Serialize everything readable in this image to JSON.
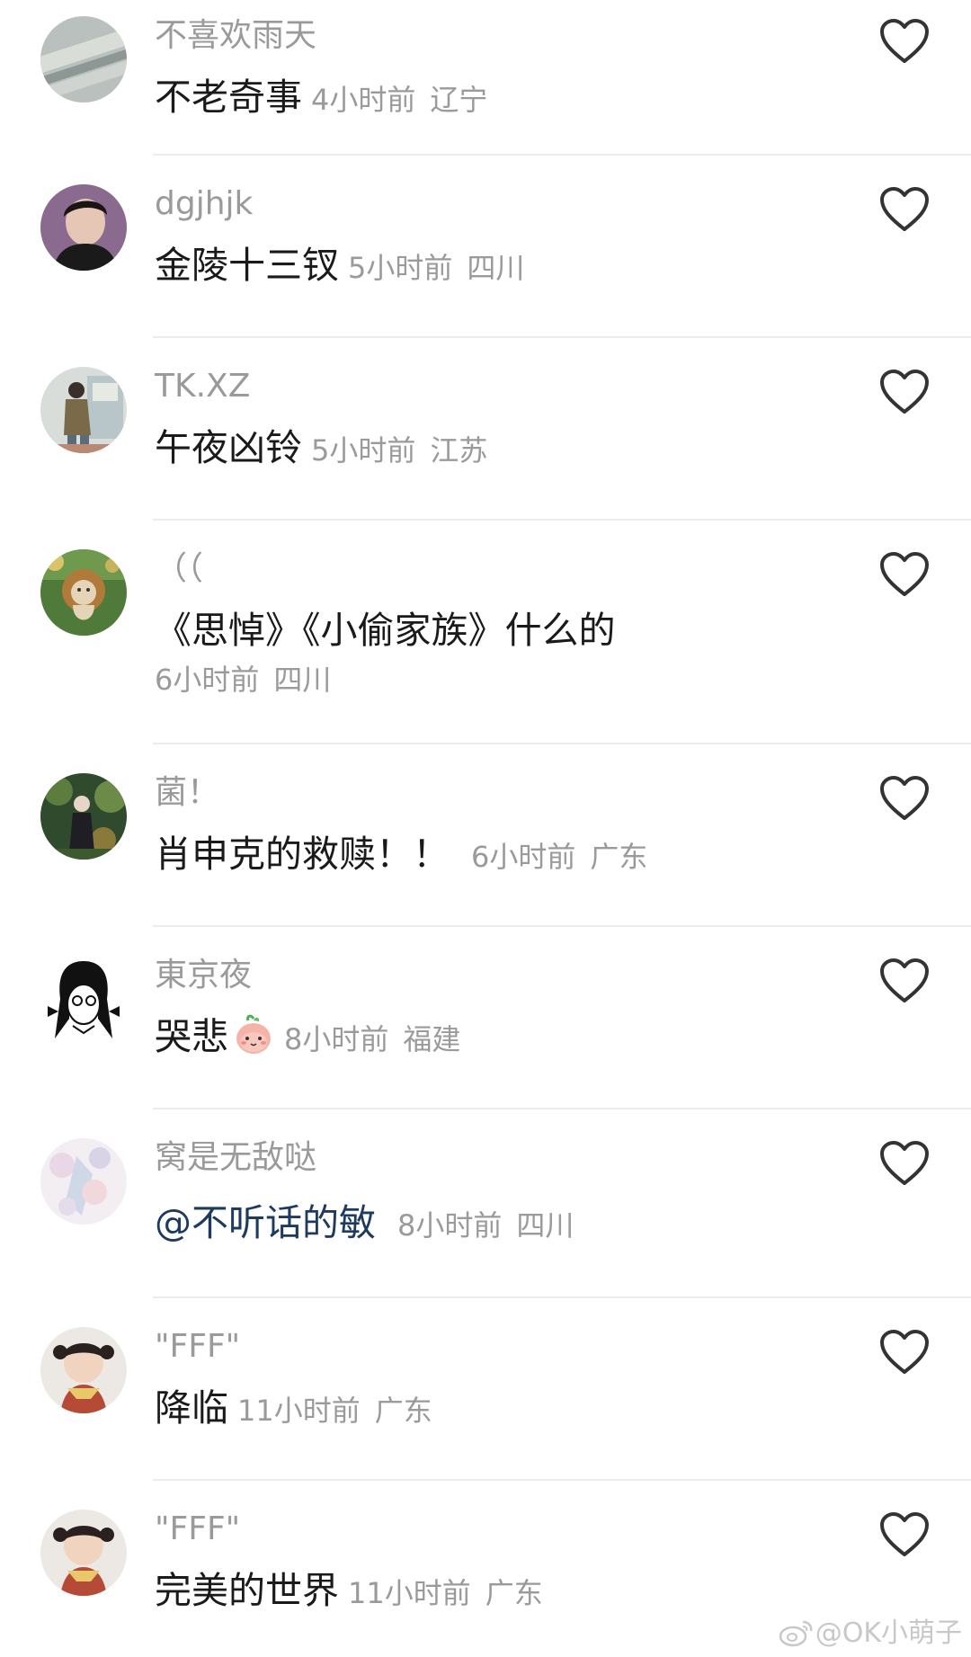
{
  "comments": [
    {
      "username": "不喜欢雨天",
      "text": "不老奇事",
      "time": "4小时前",
      "location": "辽宁"
    },
    {
      "username": "dgjhjk",
      "text": "金陵十三钗",
      "time": "5小时前",
      "location": "四川"
    },
    {
      "username": "TK.XZ",
      "text": "午夜凶铃",
      "time": "5小时前",
      "location": "江苏"
    },
    {
      "username": "（（",
      "text": "《思悼》《小偷家族》什么的",
      "time": "6小时前",
      "location": "四川"
    },
    {
      "username": "菌！",
      "text": "肖申克的救赎！！",
      "time": "6小时前",
      "location": "广东"
    },
    {
      "username": "東京夜",
      "text": "哭悲",
      "time": "8小时前",
      "location": "福建"
    },
    {
      "username": "窝是无敌哒",
      "text": "@不听话的敏",
      "time": "8小时前",
      "location": "四川"
    },
    {
      "username": "\"FFF\"",
      "text": "降临",
      "time": "11小时前",
      "location": "广东"
    },
    {
      "username": "\"FFF\"",
      "text": "完美的世界",
      "time": "11小时前",
      "location": "广东"
    }
  ],
  "icons": {
    "like": "heart-outline-icon",
    "reaction_emoji": "peach-face-emoji"
  },
  "colors": {
    "username": "#9a9a9a",
    "text": "#1a1a1a",
    "mention": "#1e3a5f",
    "meta": "#9a9a9a",
    "heart_stroke": "#333333"
  },
  "watermark": "@OK小萌子"
}
